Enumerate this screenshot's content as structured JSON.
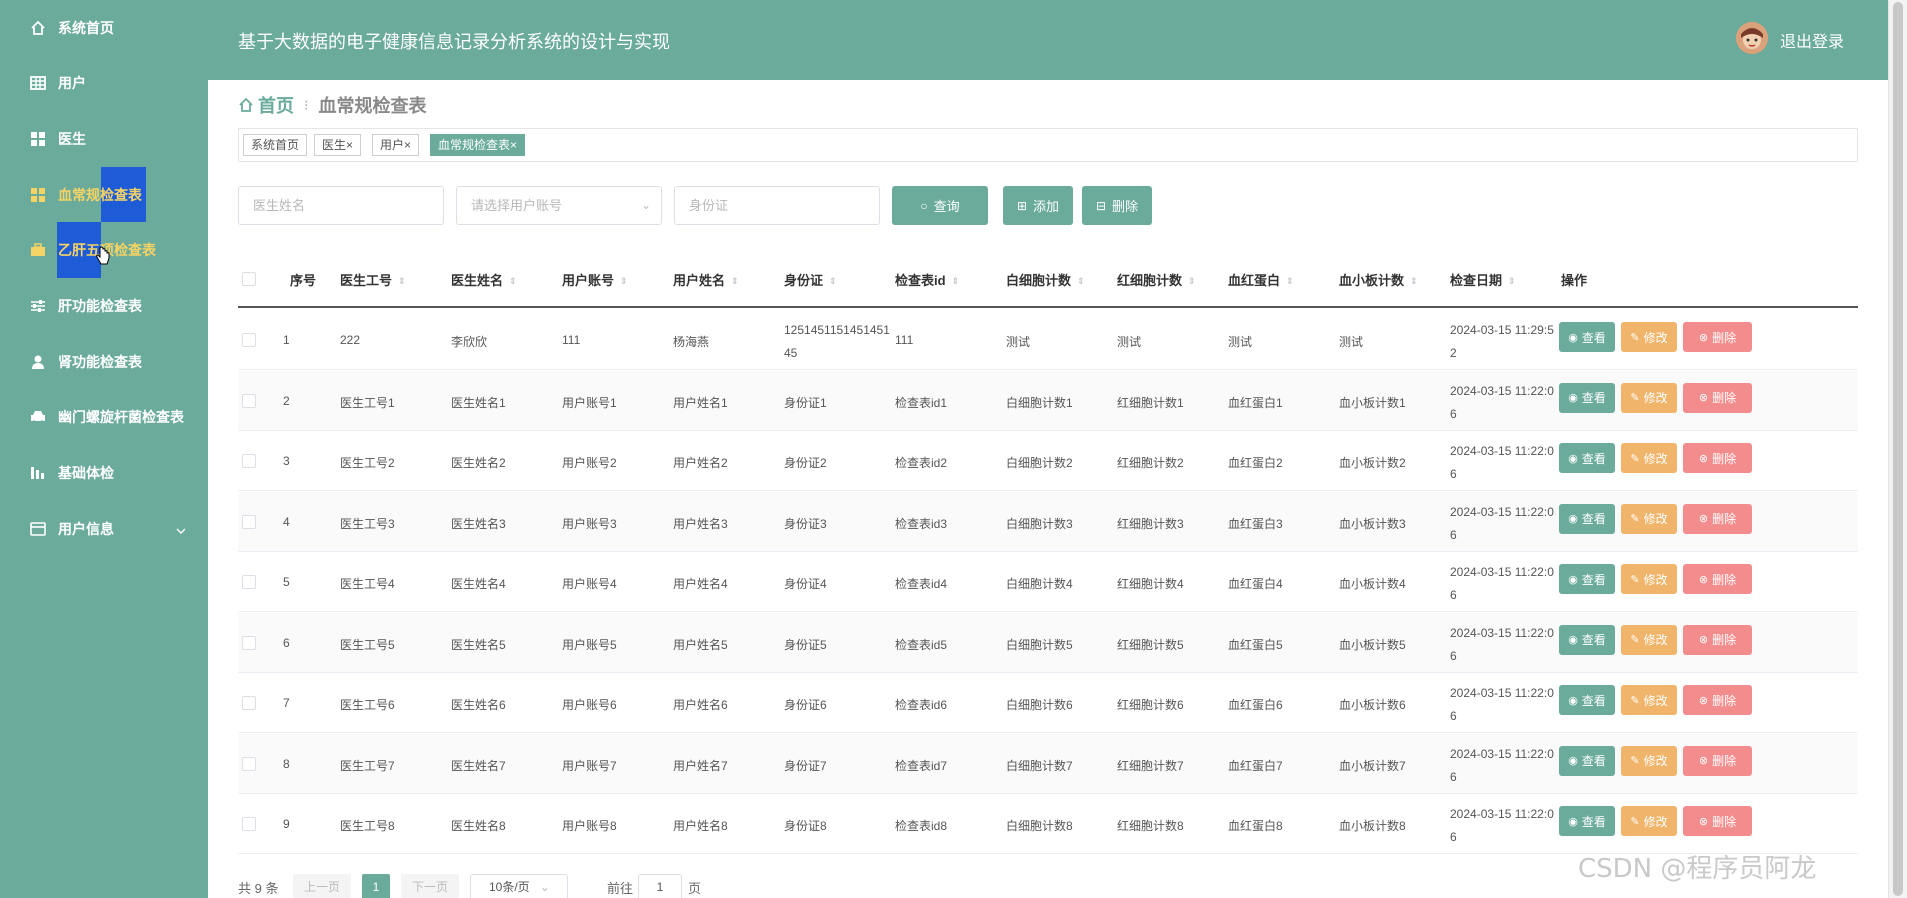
{
  "sidebar": {
    "items": [
      {
        "label": "系统首页",
        "icon": "home-icon"
      },
      {
        "label": "用户",
        "icon": "grid-icon"
      },
      {
        "label": "医生",
        "icon": "grid-icon"
      },
      {
        "label": "血常规检查表",
        "icon": "grid-icon"
      },
      {
        "label": "乙肝五项检查表",
        "icon": "briefcase-icon"
      },
      {
        "label": "肝功能检查表",
        "icon": "sliders-icon"
      },
      {
        "label": "肾功能检查表",
        "icon": "user-icon"
      },
      {
        "label": "幽门螺旋杆菌检查表",
        "icon": "car-icon"
      },
      {
        "label": "基础体检",
        "icon": "bars-icon"
      },
      {
        "label": "用户信息",
        "icon": "card-icon"
      }
    ]
  },
  "header": {
    "title": "基于大数据的电子健康信息记录分析系统的设计与实现",
    "logout": "退出登录"
  },
  "breadcrumb": {
    "home": "首页",
    "current": "血常规检查表"
  },
  "tags": [
    "系统首页",
    "医生",
    "用户",
    "血常规检查表"
  ],
  "tag_close": "×",
  "search": {
    "doctor_name_placeholder": "医生姓名",
    "account_placeholder": "请选择用户账号",
    "idcard_placeholder": "身份证",
    "query": "查询",
    "add": "添加",
    "delete": "删除"
  },
  "table": {
    "headers": [
      "序号",
      "医生工号",
      "医生姓名",
      "用户账号",
      "用户姓名",
      "身份证",
      "检查表id",
      "白细胞计数",
      "红细胞计数",
      "血红蛋白",
      "血小板计数",
      "检查日期",
      "操作"
    ],
    "rows": [
      [
        "1",
        "222",
        "李欣欣",
        "111",
        "杨海燕",
        "125145115145145145",
        "111",
        "测试",
        "测试",
        "测试",
        "测试",
        "2024-03-15 11:29:52"
      ],
      [
        "2",
        "医生工号1",
        "医生姓名1",
        "用户账号1",
        "用户姓名1",
        "身份证1",
        "检查表id1",
        "白细胞计数1",
        "红细胞计数1",
        "血红蛋白1",
        "血小板计数1",
        "2024-03-15 11:22:06"
      ],
      [
        "3",
        "医生工号2",
        "医生姓名2",
        "用户账号2",
        "用户姓名2",
        "身份证2",
        "检查表id2",
        "白细胞计数2",
        "红细胞计数2",
        "血红蛋白2",
        "血小板计数2",
        "2024-03-15 11:22:06"
      ],
      [
        "4",
        "医生工号3",
        "医生姓名3",
        "用户账号3",
        "用户姓名3",
        "身份证3",
        "检查表id3",
        "白细胞计数3",
        "红细胞计数3",
        "血红蛋白3",
        "血小板计数3",
        "2024-03-15 11:22:06"
      ],
      [
        "5",
        "医生工号4",
        "医生姓名4",
        "用户账号4",
        "用户姓名4",
        "身份证4",
        "检查表id4",
        "白细胞计数4",
        "红细胞计数4",
        "血红蛋白4",
        "血小板计数4",
        "2024-03-15 11:22:06"
      ],
      [
        "6",
        "医生工号5",
        "医生姓名5",
        "用户账号5",
        "用户姓名5",
        "身份证5",
        "检查表id5",
        "白细胞计数5",
        "红细胞计数5",
        "血红蛋白5",
        "血小板计数5",
        "2024-03-15 11:22:06"
      ],
      [
        "7",
        "医生工号6",
        "医生姓名6",
        "用户账号6",
        "用户姓名6",
        "身份证6",
        "检查表id6",
        "白细胞计数6",
        "红细胞计数6",
        "血红蛋白6",
        "血小板计数6",
        "2024-03-15 11:22:06"
      ],
      [
        "8",
        "医生工号7",
        "医生姓名7",
        "用户账号7",
        "用户姓名7",
        "身份证7",
        "检查表id7",
        "白细胞计数7",
        "红细胞计数7",
        "血红蛋白7",
        "血小板计数7",
        "2024-03-15 11:22:06"
      ],
      [
        "9",
        "医生工号8",
        "医生姓名8",
        "用户账号8",
        "用户姓名8",
        "身份证8",
        "检查表id8",
        "白细胞计数8",
        "红细胞计数8",
        "血红蛋白8",
        "血小板计数8",
        "2024-03-15 11:22:06"
      ]
    ],
    "actions": {
      "view": "查看",
      "edit": "修改",
      "delete": "删除"
    }
  },
  "pagination": {
    "total": "共 9 条",
    "prev": "上一页",
    "current": "1",
    "next": "下一页",
    "page_size": "10条/页",
    "goto_prefix": "前往",
    "goto_value": "1",
    "goto_suffix": "页"
  },
  "watermark": "CSDN @程序员阿龙",
  "colors": {
    "primary": "#6aab9c",
    "edit": "#f0b56a",
    "delete": "#f38c8c",
    "highlight": "#1e5bd6"
  }
}
